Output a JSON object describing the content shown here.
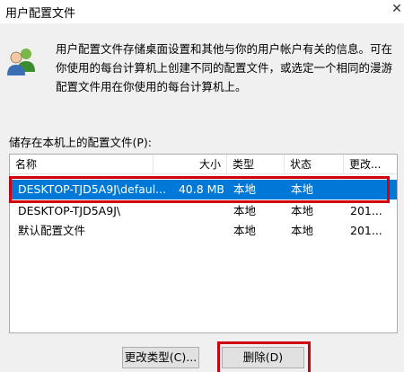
{
  "window": {
    "title": "用户配置文件"
  },
  "description": "用户配置文件存储桌面设置和其他与你的用户帐户有关的信息。可在你使用的每台计算机上创建不同的配置文件，或选定一个相同的漫游配置文件用在你使用的每台计算机上。",
  "list_label": "储存在本机上的配置文件(P):",
  "columns": [
    "名称",
    "大小",
    "类型",
    "状态",
    "更改..."
  ],
  "rows": [
    {
      "name": "DESKTOP-TJD5A9J\\defaul...",
      "size": "40.8 MB",
      "type": "本地",
      "status": "本地",
      "changed": ""
    },
    {
      "name": "DESKTOP-TJD5A9J\\",
      "size": "",
      "type": "本地",
      "status": "本地",
      "changed": "201..."
    },
    {
      "name": "默认配置文件",
      "size": "",
      "type": "本地",
      "status": "本地",
      "changed": "201..."
    }
  ],
  "buttons": {
    "change_type": "更改类型(C)...",
    "delete": "删除(D)"
  },
  "colors": {
    "selection": "#0078d7",
    "annotation": "#d0000f"
  },
  "icons": {
    "users": "users-icon",
    "close": "close-icon"
  }
}
